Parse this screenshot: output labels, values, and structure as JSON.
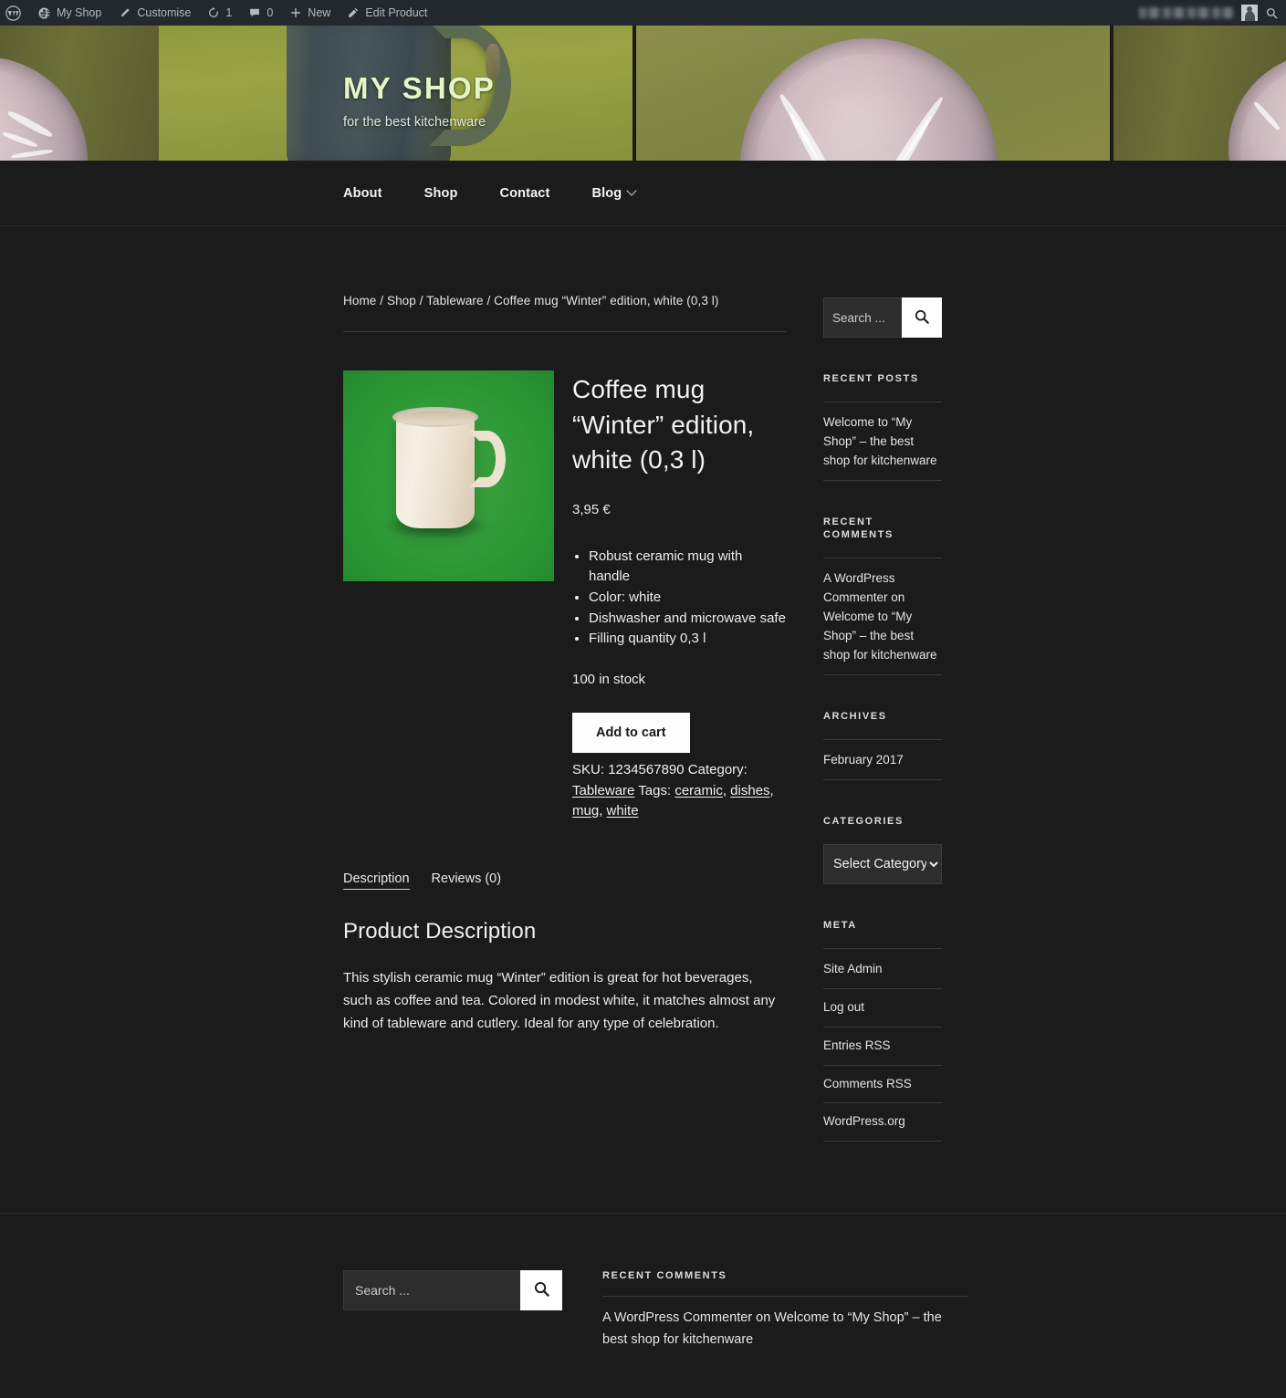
{
  "adminbar": {
    "items": [
      {
        "icon": "wordpress-logo-icon",
        "label": ""
      },
      {
        "icon": "site-icon",
        "label": "My Shop"
      },
      {
        "icon": "pencil-icon",
        "label": "Customise"
      },
      {
        "icon": "updates-icon",
        "label": "1"
      },
      {
        "icon": "comment-bubble-icon",
        "label": "0"
      },
      {
        "icon": "plus-icon",
        "label": "New"
      },
      {
        "icon": "edit-icon",
        "label": "Edit Product"
      }
    ],
    "search_icon": "search-icon",
    "avatar_icon": "avatar-icon"
  },
  "header": {
    "site_title": "MY SHOP",
    "tagline": "for the best kitchenware",
    "title_color": "#e4f5c6"
  },
  "nav": {
    "items": [
      {
        "label": "About",
        "has_dropdown": false
      },
      {
        "label": "Shop",
        "has_dropdown": false
      },
      {
        "label": "Contact",
        "has_dropdown": false
      },
      {
        "label": "Blog",
        "has_dropdown": true
      }
    ]
  },
  "breadcrumb": "Home / Shop / Tableware / Coffee mug “Winter” edition, white (0,3 l)",
  "product": {
    "image_alt": "white ceramic coffee mug on green background",
    "title": "Coffee mug “Winter” edition, white (0,3 l)",
    "price": "3,95 €",
    "features": [
      "Robust ceramic mug with  handle",
      "Color: white",
      "Dishwasher and microwave safe",
      "Filling quantity 0,3 l"
    ],
    "stock": "100 in stock",
    "add_to_cart_label": "Add to cart",
    "sku_label": "SKU:",
    "sku_value": "1234567890",
    "category_label": "Category:",
    "category_value": "Tableware",
    "tags_label": "Tags:",
    "tags": [
      "ceramic",
      "dishes",
      "mug",
      "white"
    ]
  },
  "tabs": [
    {
      "label": "Description",
      "active": true
    },
    {
      "label": "Reviews (0)",
      "active": false
    }
  ],
  "description": {
    "heading": "Product Description",
    "body": "This stylish ceramic mug “Winter” edition is great for hot beverages, such as coffee and tea. Colored in modest white, it matches almost any kind of tableware and cutlery. Ideal for any type of celebration."
  },
  "sidebar": {
    "search": {
      "placeholder": "Search ...",
      "value": "",
      "icon": "search-icon"
    },
    "widgets": [
      {
        "title": "Recent Posts",
        "items": [
          "Welcome to “My Shop” – the best shop for kitchenware"
        ]
      },
      {
        "title": "Recent Comments",
        "items": [
          "A WordPress Commenter on Welcome to “My Shop” – the best shop for kitchenware"
        ]
      },
      {
        "title": "Archives",
        "items": [
          "February 2017"
        ]
      }
    ],
    "categories": {
      "title": "Categories",
      "selected": "Select Category",
      "options": [
        "Select Category"
      ]
    },
    "meta": {
      "title": "Meta",
      "items": [
        "Site Admin",
        "Log out",
        "Entries RSS",
        "Comments RSS",
        "WordPress.org"
      ]
    }
  },
  "footer": {
    "search": {
      "placeholder": "Search ...",
      "value": "",
      "icon": "search-icon"
    },
    "recent_comments": {
      "title": "Recent Comments",
      "items": [
        "A WordPress Commenter on Welcome to “My Shop” – the best shop for kitchenware"
      ]
    }
  }
}
